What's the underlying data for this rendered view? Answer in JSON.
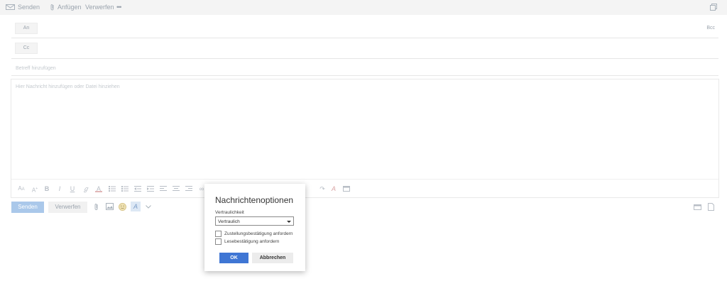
{
  "toolbar": {
    "send_label": "Senden",
    "attach_label": "Anfügen",
    "discard_label": "Verwerfen",
    "more_label": "•••"
  },
  "recipients": {
    "to_label": "An",
    "cc_label": "Cc",
    "bcc_label": "Bcc"
  },
  "subject": {
    "placeholder": "Betreff hinzufügen"
  },
  "body": {
    "placeholder": "Hier Nachricht hinzufügen oder Datei hinziehen"
  },
  "actions": {
    "send_label": "Senden",
    "discard_label": "Verwerfen"
  },
  "dialog": {
    "title": "Nachrichtenoptionen",
    "sensitivity_label": "Vertraulichkeit",
    "sensitivity_value": "Vertraulich",
    "delivery_receipt_label": "Zustellungsbestätigung anfordern",
    "delivery_receipt_checked": false,
    "read_receipt_label": "Lesebestätigung anfordern",
    "read_receipt_checked": false,
    "ok_label": "OK",
    "cancel_label": "Abbrechen"
  },
  "colors": {
    "accent": "#3f76d4",
    "send_disabled": "#aac8ea"
  }
}
